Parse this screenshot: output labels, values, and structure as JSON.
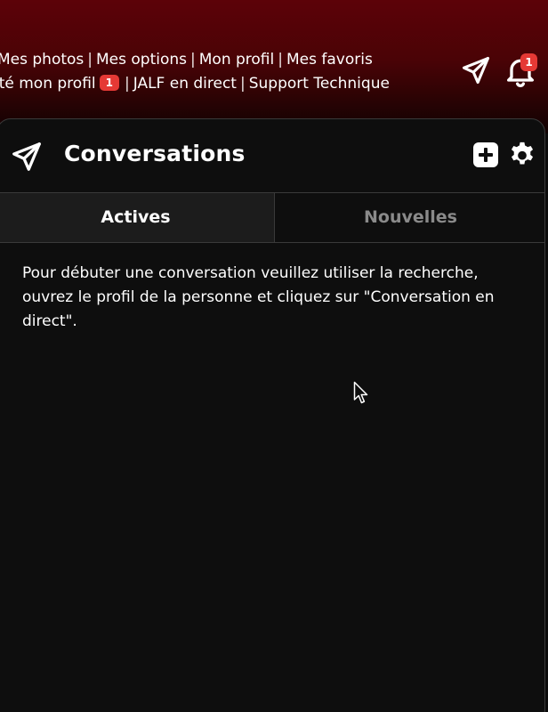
{
  "header": {
    "nav_line_1": [
      {
        "label": "Mes photos"
      },
      {
        "label": "Mes options"
      },
      {
        "label": "Mon profil"
      },
      {
        "label": "Mes favoris"
      }
    ],
    "nav_line_2": {
      "visit_label": "lté mon profil",
      "visit_badge": "1",
      "live_label": "JALF en direct",
      "support_label": "Support Technique"
    },
    "separator": "|",
    "icons": {
      "send": "send-icon",
      "bell": "bell-icon"
    },
    "notification_count": "1"
  },
  "panel": {
    "title": "Conversations",
    "icons": {
      "send": "send-icon",
      "add": "add-square-icon",
      "settings": "gear-icon"
    },
    "tabs": [
      {
        "label": "Actives",
        "active": true
      },
      {
        "label": "Nouvelles",
        "active": false
      }
    ],
    "message": "Pour débuter une conversation veuillez utiliser la recherche, ouvrez le profil de la personne et cliquez sur \"Conversation en direct\"."
  },
  "colors": {
    "header_bg": "#5c0208",
    "badge": "#e53935",
    "panel_bg": "#0e0e0e",
    "tab_active_bg": "#1c1c1c",
    "tab_inactive_text": "#8a8a8a"
  }
}
